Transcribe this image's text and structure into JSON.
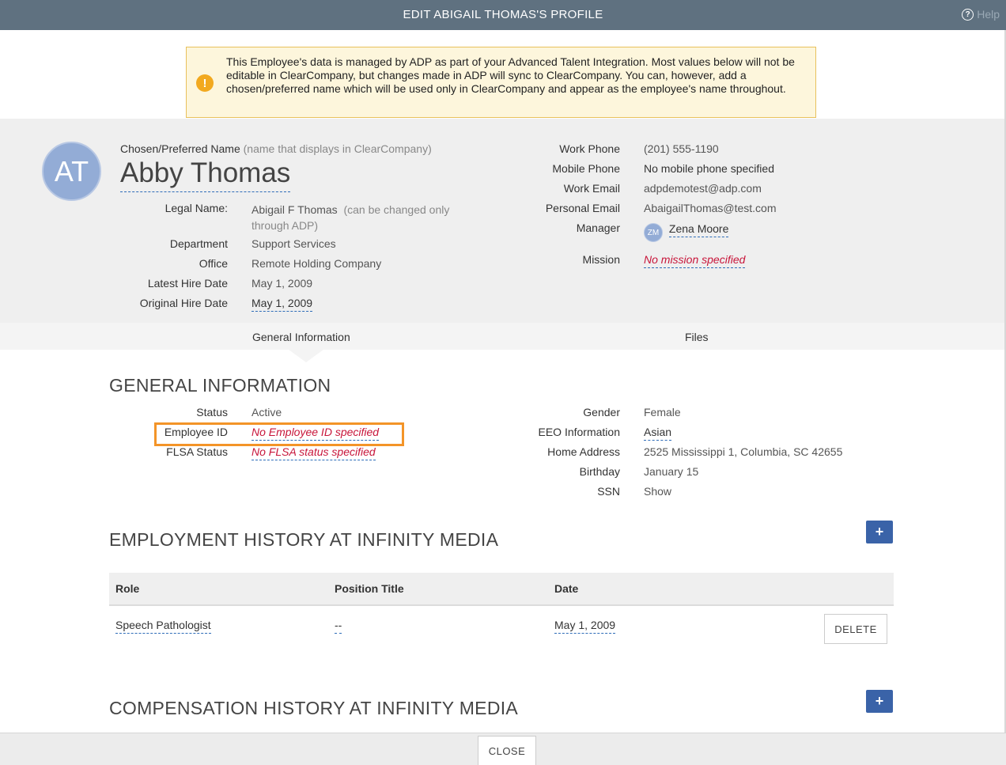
{
  "window": {
    "title": "EDIT ABIGAIL THOMAS'S PROFILE",
    "help_label": "Help"
  },
  "alert": {
    "message": "This Employee's data is managed by ADP as part of your Advanced Talent Integration. Most values below will not be editable in ClearCompany, but changes made in ADP will sync to ClearCompany. You can, however, add a chosen/preferred name which will be used only in ClearCompany and appear as the employee's name throughout."
  },
  "profile": {
    "avatar_initials": "AT",
    "chosen_label": "Chosen/Preferred Name",
    "chosen_sub": "(name that displays in ClearCompany)",
    "chosen_name": "Abby Thomas",
    "legal_name_label": "Legal Name:",
    "legal_name": "Abigail F Thomas",
    "legal_note": "(can be changed only through ADP)",
    "department_label": "Department",
    "department": "Support Services",
    "office_label": "Office",
    "office": "Remote Holding Company",
    "latest_hire_label": "Latest Hire Date",
    "latest_hire": "May 1, 2009",
    "original_hire_label": "Original Hire Date",
    "original_hire": "May 1, 2009",
    "work_phone_label": "Work Phone",
    "work_phone": "(201) 555-1190",
    "mobile_phone_label": "Mobile Phone",
    "mobile_phone": "No mobile phone specified",
    "work_email_label": "Work Email",
    "work_email": "adpdemotest@adp.com",
    "personal_email_label": "Personal Email",
    "personal_email": "AbaigailThomas@test.com",
    "manager_label": "Manager",
    "manager_initials": "ZM",
    "manager": "Zena Moore",
    "mission_label": "Mission",
    "mission": "No mission specified"
  },
  "tabs": [
    "General Information",
    "Files"
  ],
  "general": {
    "title": "GENERAL INFORMATION",
    "status_label": "Status",
    "status": "Active",
    "employee_id_label": "Employee ID",
    "employee_id": "No Employee ID specified",
    "flsa_label": "FLSA Status",
    "flsa": "No FLSA status specified",
    "gender_label": "Gender",
    "gender": "Female",
    "eeo_label": "EEO Information",
    "eeo": "Asian",
    "address_label": "Home Address",
    "address": "2525 Mississippi 1, Columbia, SC 42655",
    "birthday_label": "Birthday",
    "birthday": "January 15",
    "ssn_label": "SSN",
    "ssn": "Show"
  },
  "employment": {
    "title": "EMPLOYMENT HISTORY AT INFINITY MEDIA",
    "add_label": "+",
    "columns": [
      "Role",
      "Position Title",
      "Date"
    ],
    "rows": [
      {
        "role": "Speech Pathologist",
        "position": "--",
        "date": "May 1, 2009",
        "action": "DELETE"
      }
    ]
  },
  "compensation": {
    "title": "COMPENSATION HISTORY AT INFINITY MEDIA",
    "add_label": "+"
  },
  "footer": {
    "close_label": "CLOSE"
  }
}
